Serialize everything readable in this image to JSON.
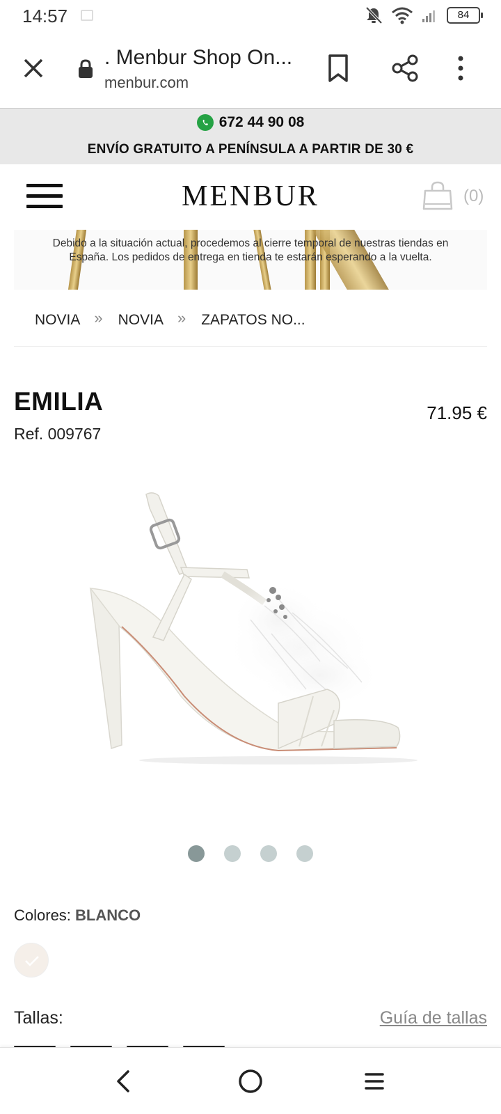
{
  "status_bar": {
    "time": "14:57",
    "battery": "84",
    "icons": [
      "image-icon",
      "mute-icon",
      "wifi-icon",
      "signal-icon",
      "battery-icon"
    ]
  },
  "browser": {
    "page_title": ". Menbur Shop On...",
    "url": "menbur.com",
    "icons": [
      "close-icon",
      "lock-icon",
      "bookmark-icon",
      "share-icon",
      "more-vert-icon"
    ]
  },
  "promo": {
    "phone": "672 44 90 08",
    "shipping": "ENVÍO GRATUITO A PENÍNSULA A PARTIR DE 30 €",
    "phone_icon": "whatsapp-icon",
    "accent_color": "#25a244"
  },
  "header": {
    "logo": "MENBUR",
    "cart_count": "(0)"
  },
  "notice": {
    "text": "Debido a la situación actual, procedemos al cierre temporal de nuestras tiendas en España. Los pedidos de entrega en tienda te estarán esperando a la vuelta."
  },
  "breadcrumb": {
    "items": [
      "NOVIA",
      "NOVIA",
      "ZAPATOS NO..."
    ],
    "separator": "»"
  },
  "product": {
    "name": "EMILIA",
    "ref": "Ref. 009767",
    "price": "71.95 €",
    "image_count": 4,
    "active_image": 1,
    "colors_label": "Colores:",
    "color_value": "BLANCO",
    "sizes_label": "Tallas:",
    "size_guide": "Guía de tallas"
  },
  "nav": {
    "icons": [
      "back-icon",
      "home-icon",
      "recents-icon"
    ]
  }
}
